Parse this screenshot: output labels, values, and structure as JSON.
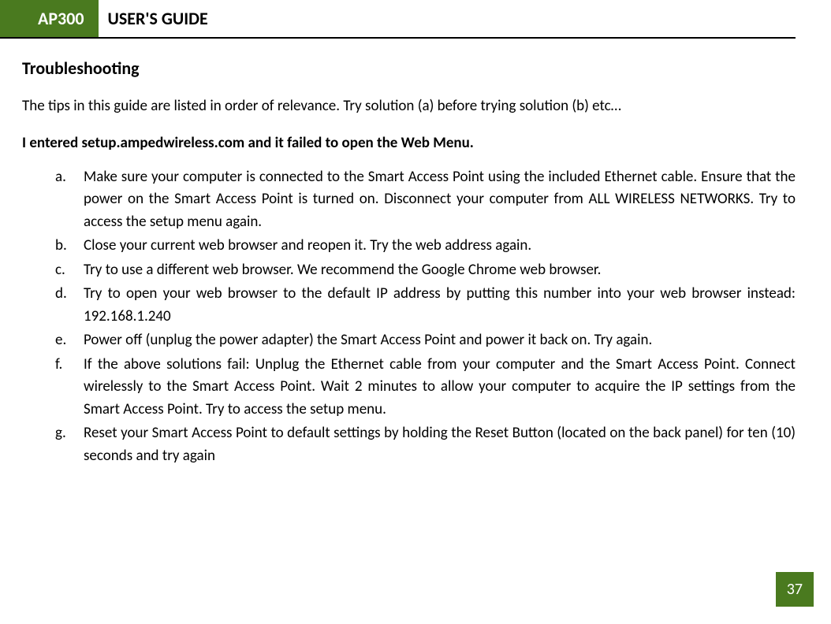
{
  "header": {
    "badge": "AP300",
    "title": "USER'S GUIDE"
  },
  "section": {
    "heading": "Troubleshooting",
    "intro": "The tips in this guide are listed in order of relevance.  Try solution (a) before trying solution (b) etc…",
    "problem": "I entered setup.ampedwireless.com and it failed to open the Web Menu.",
    "solutions": [
      {
        "marker": "a.",
        "text": "Make sure your computer is connected to the Smart Access Point using the included Ethernet cable. Ensure that the power on the Smart Access Point is turned on.   Disconnect your computer from ALL WIRELESS NETWORKS.  Try to access the setup menu again."
      },
      {
        "marker": "b.",
        "text": "Close your current web browser and reopen it.  Try the web address again."
      },
      {
        "marker": "c.",
        "text": "Try to use a different web browser.  We recommend the Google Chrome web browser."
      },
      {
        "marker": "d.",
        "text": "Try to open your web browser to the default IP address by putting this number into your web browser instead: 192.168.1.240"
      },
      {
        "marker": "e.",
        "text": "Power off (unplug the power adapter) the Smart Access Point and power it back on.  Try again."
      },
      {
        "marker": "f.",
        "text": "If the above solutions fail: Unplug the Ethernet cable from your computer and the Smart Access Point. Connect wirelessly to the Smart Access Point.  Wait 2 minutes to allow your computer to acquire the IP settings from the Smart Access Point.  Try to access the setup menu."
      },
      {
        "marker": "g.",
        "text": "Reset your Smart Access Point to default settings by holding the Reset Button (located on the back panel) for ten (10) seconds and try again"
      }
    ]
  },
  "page_number": "37"
}
